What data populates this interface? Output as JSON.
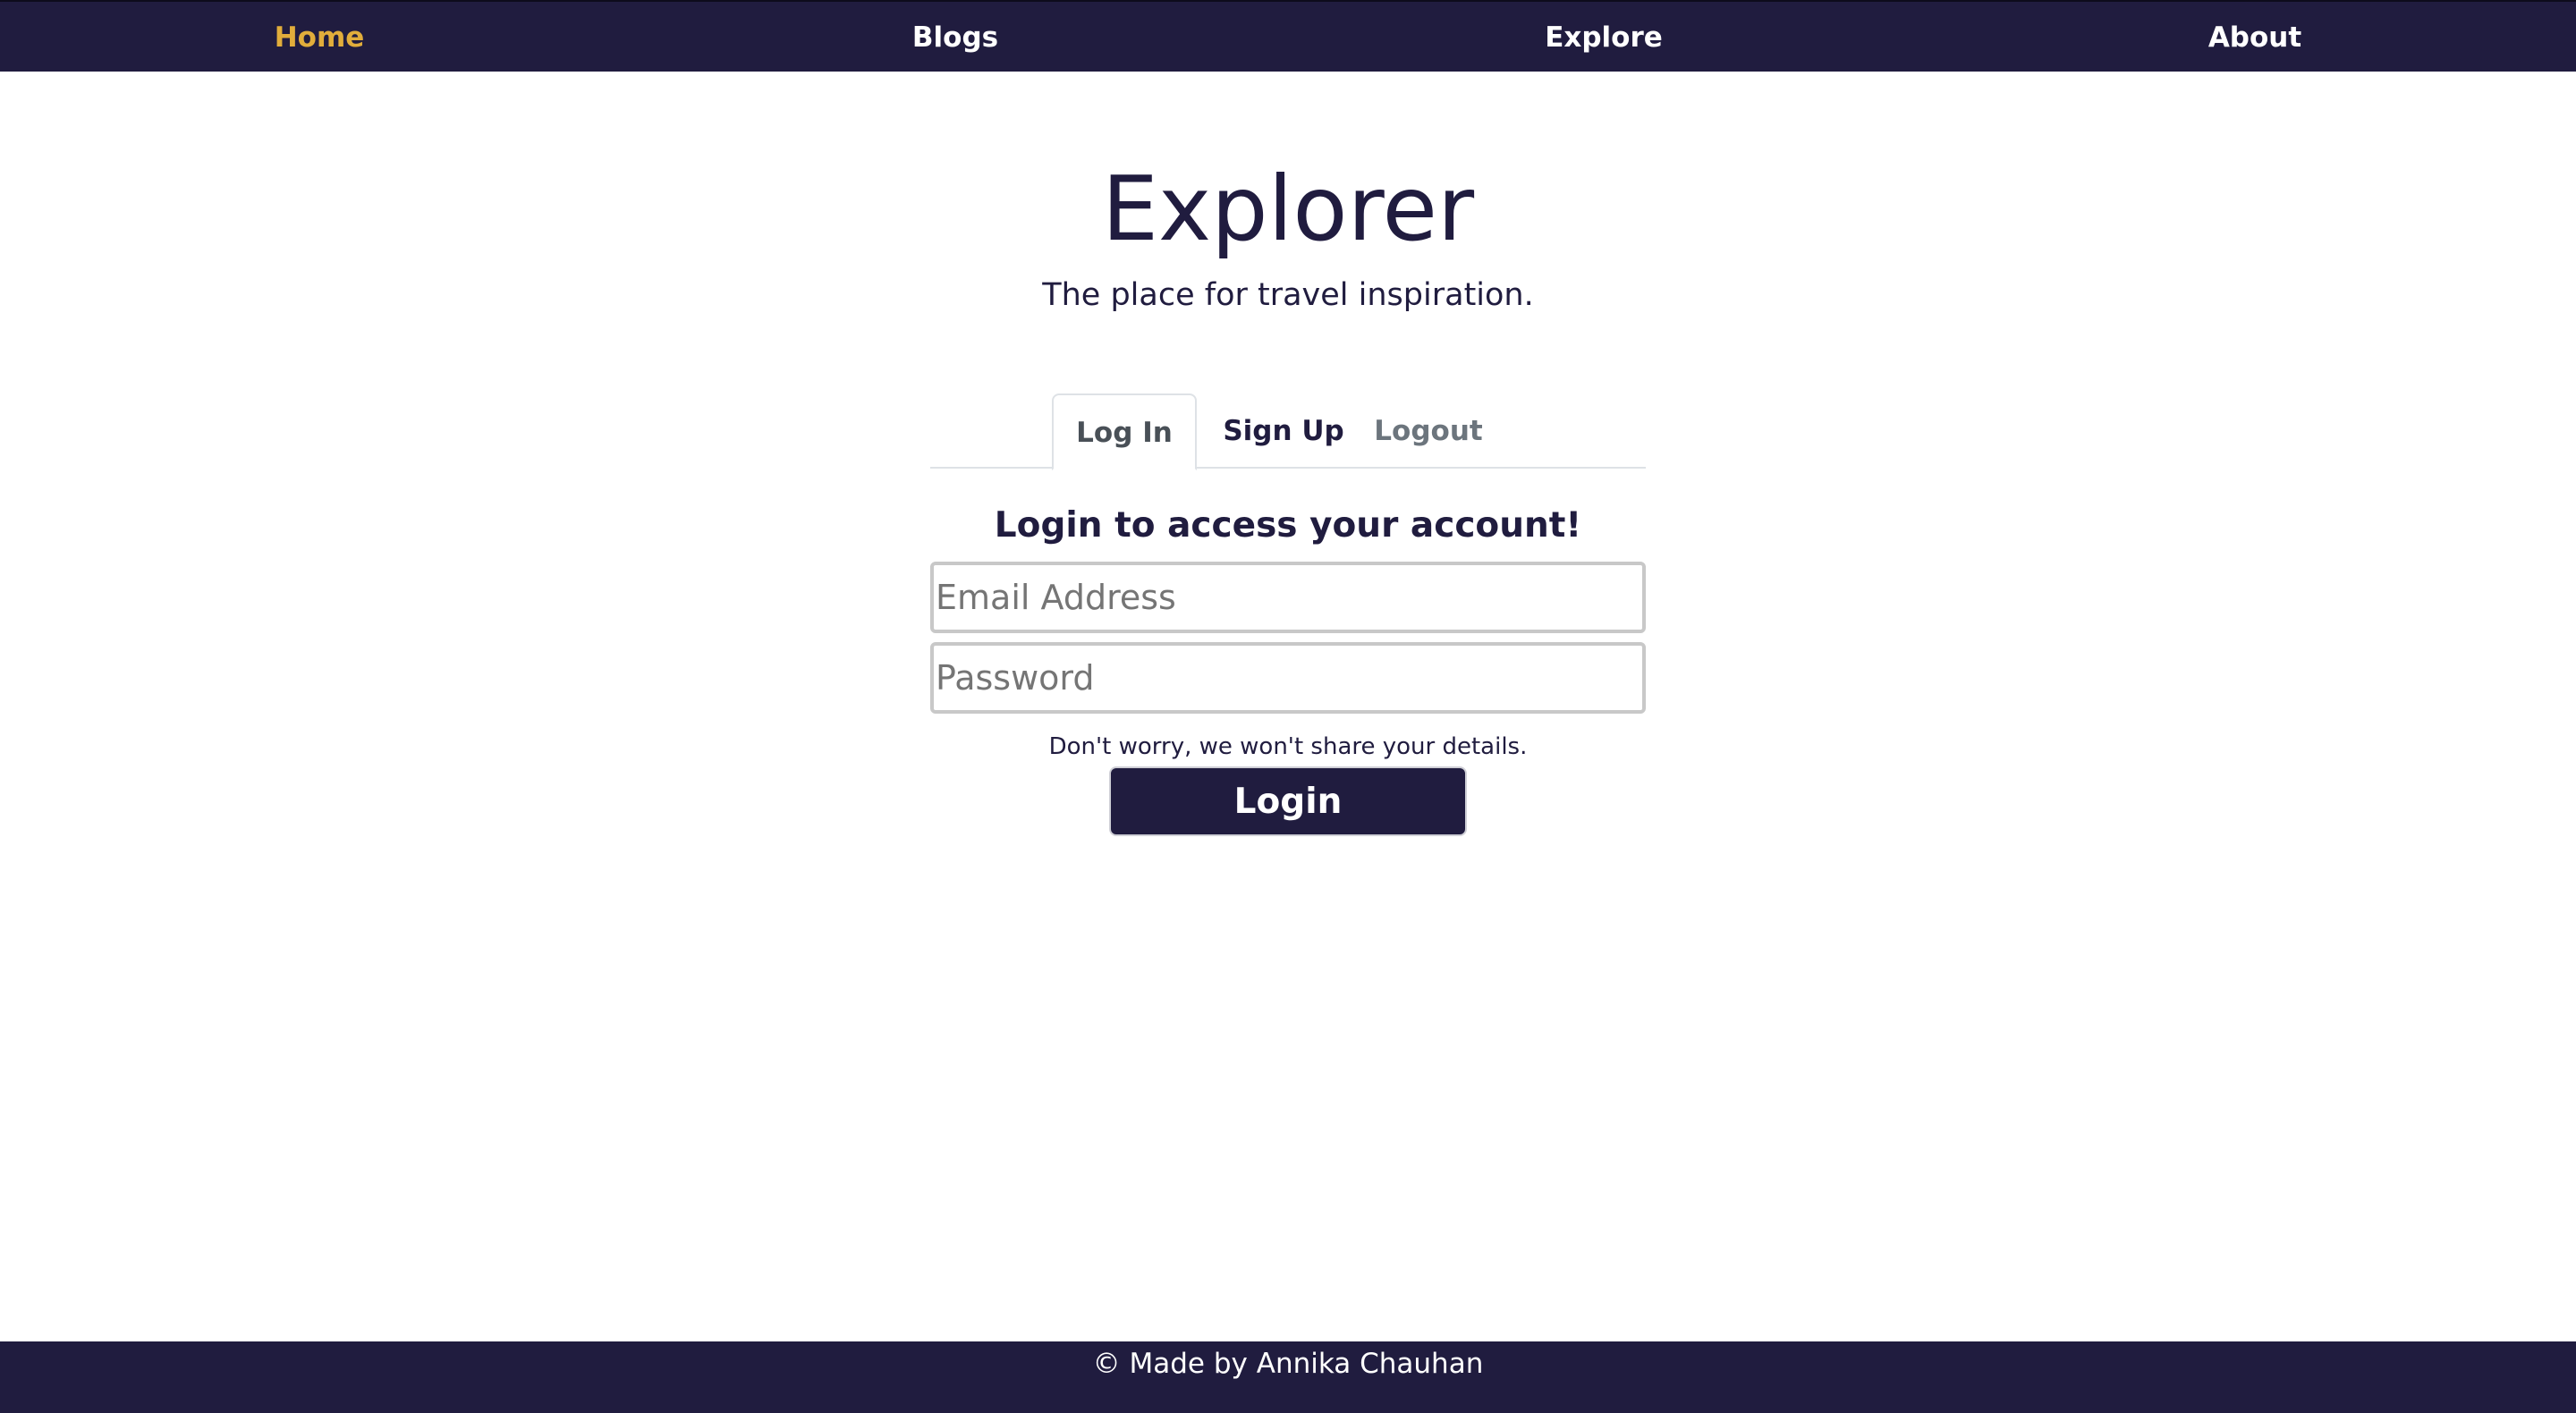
{
  "nav": {
    "items": [
      {
        "label": "Home",
        "active": true
      },
      {
        "label": "Blogs",
        "active": false
      },
      {
        "label": "Explore",
        "active": false
      },
      {
        "label": "About",
        "active": false
      }
    ],
    "active_color": "#e1ad3b",
    "background_color": "#201c3f"
  },
  "hero": {
    "title": "Explorer",
    "subtitle": "The place for travel inspiration."
  },
  "tabs": [
    {
      "label": "Log In",
      "selected": true
    },
    {
      "label": "Sign Up",
      "selected": false
    },
    {
      "label": "Logout",
      "selected": false
    }
  ],
  "form": {
    "heading": "Login to access your account!",
    "email": {
      "placeholder": "Email Address",
      "value": ""
    },
    "password": {
      "placeholder": "Password",
      "value": ""
    },
    "note": "Don't worry, we won't share your details.",
    "submit_label": "Login"
  },
  "footer": {
    "text": "© Made by Annika Chauhan"
  },
  "colors": {
    "brand": "#201c3f",
    "accent": "#e1ad3b",
    "muted_tab": "#6c757d"
  }
}
